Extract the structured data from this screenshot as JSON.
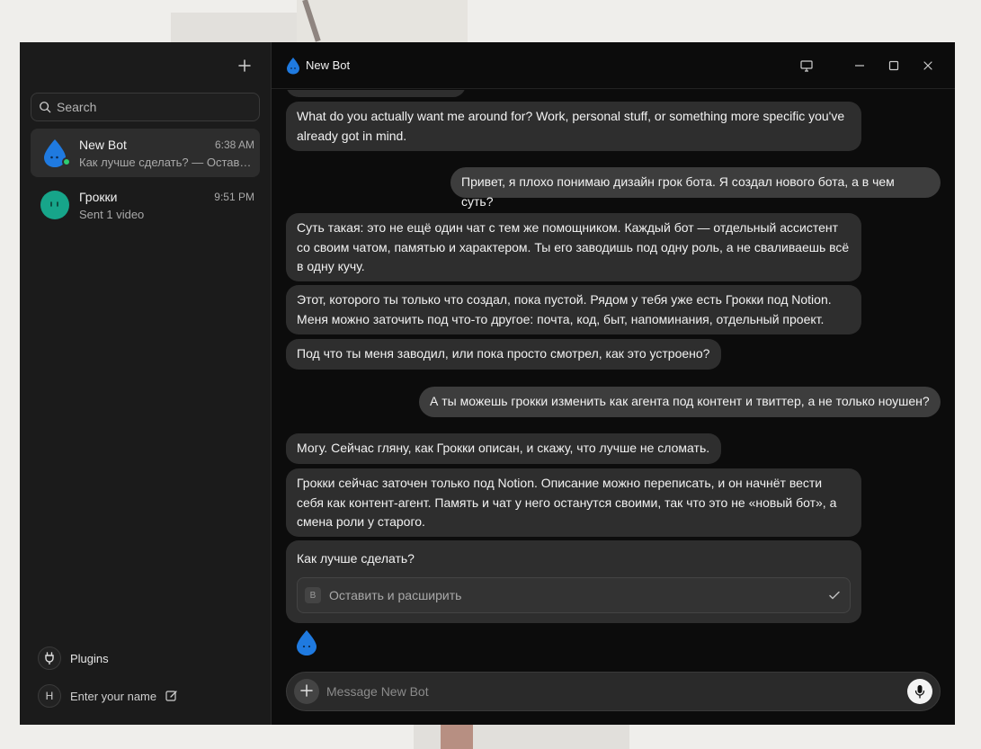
{
  "app": {
    "title": "New Bot",
    "accent": "#1f7ae0"
  },
  "sidebar": {
    "search_placeholder": "Search",
    "chats": [
      {
        "name": "New Bot",
        "time": "6:38 AM",
        "preview": "Как лучше сделать? — Оставить и расширить",
        "icon": "water-drop-icon",
        "online": true
      },
      {
        "name": "Грокки",
        "time": "9:51 PM",
        "preview": "Sent 1 video",
        "icon": "teal-face-icon",
        "online": false
      }
    ],
    "plugins_label": "Plugins",
    "profile_initial": "H",
    "profile_placeholder": "Enter your name"
  },
  "messages": [
    {
      "role": "bot",
      "text": "What do you actually want me around for? Work, personal stuff, or something more specific you've already got in mind."
    },
    {
      "role": "user",
      "text": "Привет, я плохо понимаю дизайн грок бота. Я создал нового бота, а в чем суть?"
    },
    {
      "role": "bot",
      "text": "Суть такая: это не ещё один чат с тем же помощником. Каждый бот — отдельный ассистент со своим чатом, памятью и характером. Ты его заводишь под одну роль, а не сваливаешь всё в одну кучу."
    },
    {
      "role": "bot",
      "text": "Этот, которого ты только что создал, пока пустой. Рядом у тебя уже есть Грокки под Notion. Меня можно заточить под что-то другое: почта, код, быт, напоминания, отдельный проект."
    },
    {
      "role": "bot",
      "text": "Под что ты меня заводил, или пока просто смотрел, как это устроено?"
    },
    {
      "role": "user",
      "text": "А ты можешь грокки изменить как агента под контент и твиттер, а не только ноушен?"
    },
    {
      "role": "bot",
      "text": "Могу. Сейчас гляну, как Грокки описан, и скажу, что лучше не сломать."
    },
    {
      "role": "bot",
      "text": "Грокки сейчас заточен только под Notion. Описание можно переписать, и он начнёт вести себя как контент-агент. Память и чат у него останутся своими, так что это не «новый бот», а смена роли у старого."
    }
  ],
  "choice": {
    "question": "Как лучше сделать?",
    "options": [
      {
        "key": "B",
        "label": "Оставить и расширить"
      }
    ]
  },
  "composer": {
    "placeholder": "Message New Bot"
  }
}
